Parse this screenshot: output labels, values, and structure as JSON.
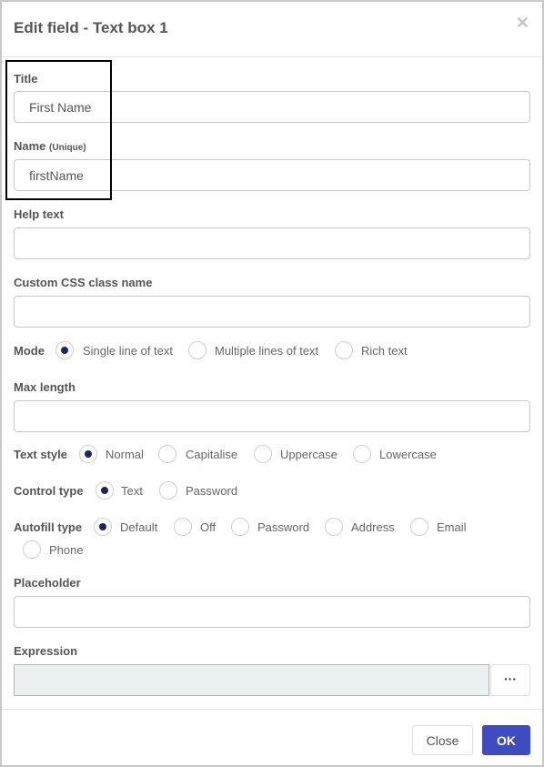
{
  "dialog": {
    "title": "Edit field - Text box 1",
    "close_icon": "close-icon"
  },
  "fields": {
    "title": {
      "label": "Title",
      "value": "First Name"
    },
    "name": {
      "label": "Name",
      "label_note": "(Unique)",
      "value": "firstName"
    },
    "help_text": {
      "label": "Help text",
      "value": ""
    },
    "css_class": {
      "label": "Custom CSS class name",
      "value": ""
    },
    "max_length": {
      "label": "Max length",
      "value": ""
    },
    "placeholder": {
      "label": "Placeholder",
      "value": ""
    },
    "expression": {
      "label": "Expression",
      "value": "",
      "button_label": "···"
    }
  },
  "mode": {
    "label": "Mode",
    "options": [
      "Single line of text",
      "Multiple lines of text",
      "Rich text"
    ],
    "selected": "Single line of text"
  },
  "text_style": {
    "label": "Text style",
    "options": [
      "Normal",
      "Capitalise",
      "Uppercase",
      "Lowercase"
    ],
    "selected": "Normal"
  },
  "control_type": {
    "label": "Control type",
    "options": [
      "Text",
      "Password"
    ],
    "selected": "Text"
  },
  "autofill_type": {
    "label": "Autofill type",
    "options": [
      "Default",
      "Off",
      "Password",
      "Address",
      "Email",
      "Phone"
    ],
    "selected": "Default"
  },
  "footer": {
    "close_label": "Close",
    "ok_label": "OK"
  },
  "colors": {
    "primary": "#3d4dbf",
    "radio_selected": "#1c2560"
  }
}
